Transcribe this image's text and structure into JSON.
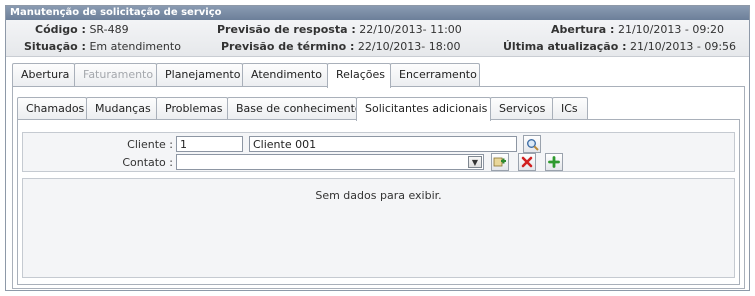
{
  "window": {
    "title": "Manutenção de solicitação de serviço"
  },
  "header": {
    "codigo_label": "Código :",
    "codigo_value": "SR-489",
    "situacao_label": "Situação :",
    "situacao_value": "Em atendimento",
    "prev_resposta_label": "Previsão de resposta :",
    "prev_resposta_value": "22/10/2013- 11:00",
    "prev_termino_label": "Previsão de término :",
    "prev_termino_value": "22/10/2013- 18:00",
    "abertura_label": "Abertura :",
    "abertura_value": "21/10/2013 - 09:20",
    "ultima_label": "Última atualização :",
    "ultima_value": "21/10/2013 - 09:56"
  },
  "main_tabs": [
    {
      "label": "Abertura"
    },
    {
      "label": "Faturamento"
    },
    {
      "label": "Planejamento"
    },
    {
      "label": "Atendimento"
    },
    {
      "label": "Relações"
    },
    {
      "label": "Encerramento"
    }
  ],
  "sub_tabs": [
    {
      "label": "Chamados"
    },
    {
      "label": "Mudanças"
    },
    {
      "label": "Problemas"
    },
    {
      "label": "Base de conhecimento"
    },
    {
      "label": "Solicitantes adicionais"
    },
    {
      "label": "Serviços"
    },
    {
      "label": "ICs"
    }
  ],
  "form": {
    "cliente_label": "Cliente :",
    "cliente_code": "1",
    "cliente_name": "Cliente 001",
    "contato_label": "Contato :",
    "contato_value": ""
  },
  "grid": {
    "empty_text": "Sem dados para exibir."
  },
  "colors": {
    "titlebar": "#6c7f99",
    "border": "#a9b0ba",
    "panel_bg": "#f4f5f7"
  }
}
